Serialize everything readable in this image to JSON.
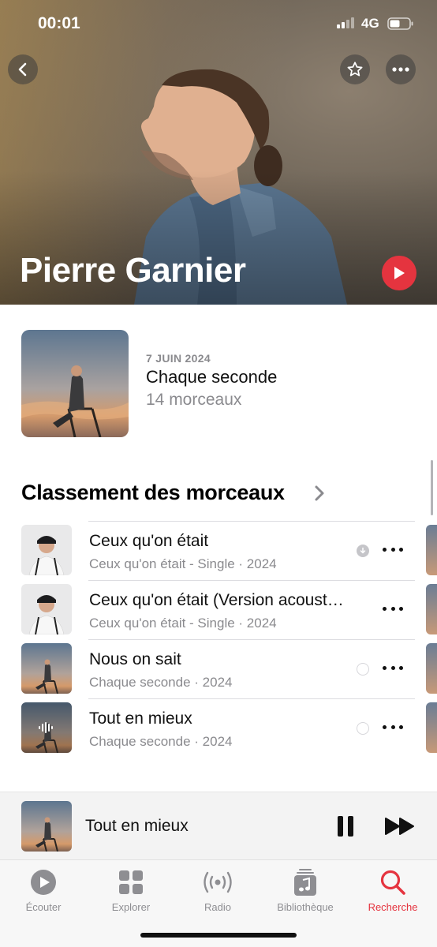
{
  "status_bar": {
    "time": "00:01",
    "network": "4G"
  },
  "artist": {
    "name": "Pierre Garnier"
  },
  "latest_release": {
    "date": "7 JUIN 2024",
    "title": "Chaque seconde",
    "track_count": "14 morceaux"
  },
  "top_songs": {
    "title": "Classement des morceaux",
    "items": [
      {
        "title": "Ceux qu'on était",
        "subtitle": "Ceux qu'on était - Single · 2024",
        "status": "downloaded"
      },
      {
        "title": "Ceux qu'on était (Version acoust…",
        "subtitle": "Ceux qu'on était - Single · 2024",
        "status": "none"
      },
      {
        "title": "Nous on sait",
        "subtitle": "Chaque seconde · 2024",
        "status": "empty"
      },
      {
        "title": "Tout en mieux",
        "subtitle": "Chaque seconde · 2024",
        "status": "empty"
      }
    ]
  },
  "now_playing": {
    "title": "Tout en mieux"
  },
  "tabs": [
    {
      "label": "Écouter",
      "icon": "play-circle-icon",
      "active": false
    },
    {
      "label": "Explorer",
      "icon": "grid-icon",
      "active": false
    },
    {
      "label": "Radio",
      "icon": "radio-waves-icon",
      "active": false
    },
    {
      "label": "Bibliothèque",
      "icon": "music-library-icon",
      "active": false
    },
    {
      "label": "Recherche",
      "icon": "search-icon",
      "active": true
    }
  ],
  "colors": {
    "accent": "#e5343f",
    "secondary_text": "#8a8a8e"
  }
}
